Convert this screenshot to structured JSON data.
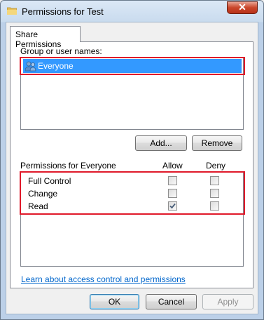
{
  "window": {
    "title": "Permissions for Test",
    "close_glyph": "✕"
  },
  "tabs": [
    {
      "label": "Share Permissions",
      "active": true
    }
  ],
  "group_list": {
    "label": "Group or user names:",
    "items": [
      {
        "name": "Everyone",
        "icon": "users-icon",
        "selected": true
      }
    ]
  },
  "buttons": {
    "add": "Add...",
    "remove": "Remove",
    "ok": "OK",
    "cancel": "Cancel",
    "apply": "Apply"
  },
  "permissions": {
    "heading": "Permissions for Everyone",
    "allow_header": "Allow",
    "deny_header": "Deny",
    "rows": [
      {
        "name": "Full Control",
        "allow": false,
        "deny": false
      },
      {
        "name": "Change",
        "allow": false,
        "deny": false
      },
      {
        "name": "Read",
        "allow": true,
        "deny": false
      }
    ]
  },
  "help_link": "Learn about access control and permissions",
  "colors": {
    "selection": "#3399ff",
    "highlight_box": "#e0192a",
    "link": "#0066cc"
  }
}
